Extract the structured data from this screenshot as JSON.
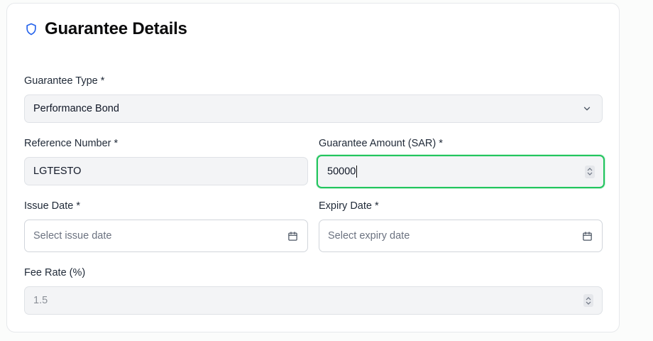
{
  "section": {
    "title": "Guarantee Details",
    "icon": "shield-icon",
    "accent_color": "#2563eb"
  },
  "fields": {
    "guarantee_type": {
      "label": "Guarantee Type *",
      "value": "Performance Bond"
    },
    "reference_number": {
      "label": "Reference Number *",
      "value": "LGTESTO"
    },
    "guarantee_amount": {
      "label": "Guarantee Amount (SAR) *",
      "value": "50000",
      "focus_color": "#22c55e"
    },
    "issue_date": {
      "label": "Issue Date *",
      "placeholder": "Select issue date",
      "icon": "calendar-icon"
    },
    "expiry_date": {
      "label": "Expiry Date *",
      "placeholder": "Select expiry date",
      "icon": "calendar-icon"
    },
    "fee_rate": {
      "label": "Fee Rate (%)",
      "value": "1.5"
    }
  }
}
